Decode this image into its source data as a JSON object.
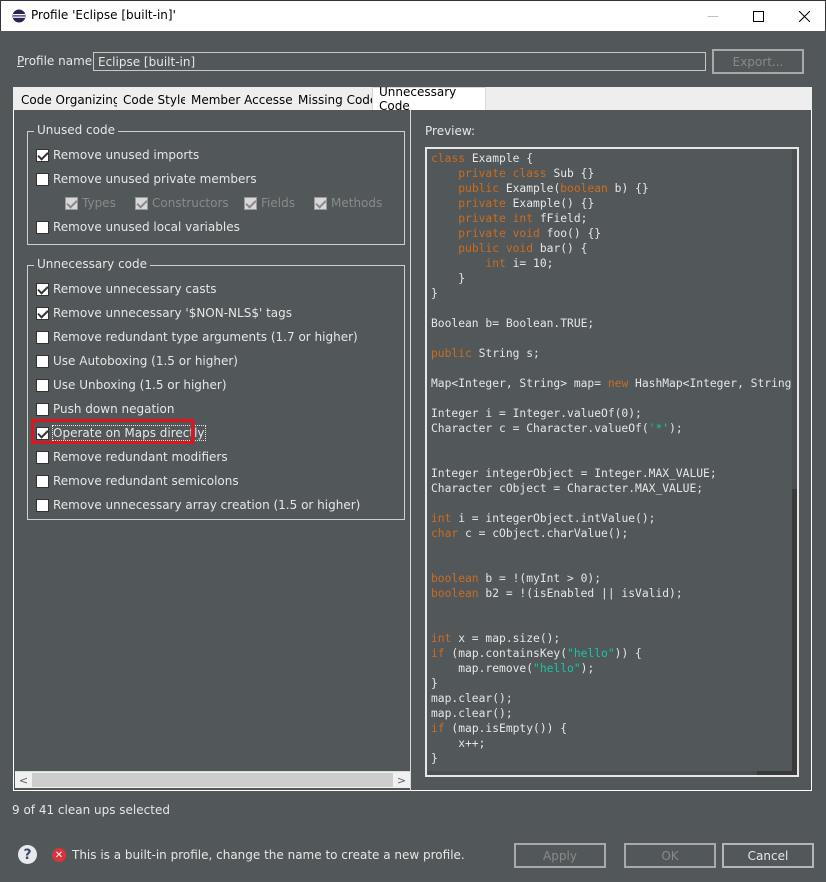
{
  "window": {
    "title": "Profile 'Eclipse [built-in]'",
    "minimize_glyph": "—",
    "maximize_glyph": "☐",
    "close_glyph": "✕"
  },
  "profile": {
    "label_prefix": "",
    "label_mnemonic": "P",
    "label_rest": "rofile name:",
    "value": "Eclipse [built-in]",
    "export_label": "Export..."
  },
  "tabs": [
    {
      "label": "Code Organizing",
      "active": false
    },
    {
      "label": "Code Style",
      "active": false
    },
    {
      "label": "Member Accesses",
      "active": false
    },
    {
      "label": "Missing Code",
      "active": false
    },
    {
      "label": "Unnecessary Code",
      "active": true
    }
  ],
  "unused_group": {
    "legend": "Unused code",
    "items": [
      {
        "label": "Remove unused imports",
        "checked": true,
        "enabled": true
      },
      {
        "label": "Remove unused private members",
        "checked": false,
        "enabled": true
      },
      {
        "label": "Remove unused local variables",
        "checked": false,
        "enabled": true
      }
    ],
    "sub_items": [
      {
        "label": "Types",
        "checked": true,
        "enabled": false
      },
      {
        "label": "Constructors",
        "checked": true,
        "enabled": false
      },
      {
        "label": "Fields",
        "checked": true,
        "enabled": false
      },
      {
        "label": "Methods",
        "checked": true,
        "enabled": false
      }
    ]
  },
  "unnecessary_group": {
    "legend": "Unnecessary code",
    "items": [
      {
        "label": "Remove unnecessary casts",
        "checked": true
      },
      {
        "label": "Remove unnecessary '$NON-NLS$' tags",
        "checked": true
      },
      {
        "label": "Remove redundant type arguments (1.7 or higher)",
        "checked": false
      },
      {
        "label": "Use Autoboxing (1.5 or higher)",
        "checked": false
      },
      {
        "label": "Use Unboxing (1.5 or higher)",
        "checked": false
      },
      {
        "label": "Push down negation",
        "checked": false
      },
      {
        "label": "Operate on Maps directly",
        "checked": true,
        "focused": true,
        "highlighted": true
      },
      {
        "label": "Remove redundant modifiers",
        "checked": false
      },
      {
        "label": "Remove redundant semicolons",
        "checked": false
      },
      {
        "label": "Remove unnecessary array creation (1.5 or higher)",
        "checked": false
      }
    ]
  },
  "preview": {
    "label": "Preview:",
    "code_lines": [
      [
        [
          "kw",
          "class"
        ],
        [
          "t",
          " Example {"
        ]
      ],
      [
        [
          "t",
          "    "
        ],
        [
          "kw",
          "private class"
        ],
        [
          "t",
          " Sub {}"
        ]
      ],
      [
        [
          "t",
          "    "
        ],
        [
          "kw",
          "public"
        ],
        [
          "t",
          " Example("
        ],
        [
          "kw",
          "boolean"
        ],
        [
          "t",
          " b) {}"
        ]
      ],
      [
        [
          "t",
          "    "
        ],
        [
          "kw",
          "private"
        ],
        [
          "t",
          " Example() {}"
        ]
      ],
      [
        [
          "t",
          "    "
        ],
        [
          "kw",
          "private int"
        ],
        [
          "t",
          " fField;"
        ]
      ],
      [
        [
          "t",
          "    "
        ],
        [
          "kw",
          "private void"
        ],
        [
          "t",
          " foo() {}"
        ]
      ],
      [
        [
          "t",
          "    "
        ],
        [
          "kw",
          "public void"
        ],
        [
          "t",
          " bar() {"
        ]
      ],
      [
        [
          "t",
          "        "
        ],
        [
          "kw",
          "int"
        ],
        [
          "t",
          " i= 10;"
        ]
      ],
      [
        [
          "t",
          "    }"
        ]
      ],
      [
        [
          "t",
          "}"
        ]
      ],
      [
        [
          "t",
          ""
        ]
      ],
      [
        [
          "t",
          "Boolean b= Boolean.TRUE;"
        ]
      ],
      [
        [
          "t",
          ""
        ]
      ],
      [
        [
          "kw",
          "public"
        ],
        [
          "t",
          " String s;"
        ]
      ],
      [
        [
          "t",
          ""
        ]
      ],
      [
        [
          "t",
          "Map<Integer, String> map= "
        ],
        [
          "kw",
          "new"
        ],
        [
          "t",
          " HashMap<Integer, String>();"
        ]
      ],
      [
        [
          "t",
          ""
        ]
      ],
      [
        [
          "t",
          "Integer i = Integer.valueOf(0);"
        ]
      ],
      [
        [
          "t",
          "Character c = Character.valueOf("
        ],
        [
          "str",
          "'*'"
        ],
        [
          "t",
          ");"
        ]
      ],
      [
        [
          "t",
          ""
        ]
      ],
      [
        [
          "t",
          ""
        ]
      ],
      [
        [
          "t",
          "Integer integerObject = Integer.MAX_VALUE;"
        ]
      ],
      [
        [
          "t",
          "Character cObject = Character.MAX_VALUE;"
        ]
      ],
      [
        [
          "t",
          ""
        ]
      ],
      [
        [
          "kw",
          "int"
        ],
        [
          "t",
          " i = integerObject.intValue();"
        ]
      ],
      [
        [
          "kw",
          "char"
        ],
        [
          "t",
          " c = cObject.charValue();"
        ]
      ],
      [
        [
          "t",
          ""
        ]
      ],
      [
        [
          "t",
          ""
        ]
      ],
      [
        [
          "kw",
          "boolean"
        ],
        [
          "t",
          " b = !(myInt > 0);"
        ]
      ],
      [
        [
          "kw",
          "boolean"
        ],
        [
          "t",
          " b2 = !(isEnabled || isValid);"
        ]
      ],
      [
        [
          "t",
          ""
        ]
      ],
      [
        [
          "t",
          ""
        ]
      ],
      [
        [
          "kw",
          "int"
        ],
        [
          "t",
          " x = map.size();"
        ]
      ],
      [
        [
          "kw",
          "if"
        ],
        [
          "t",
          " (map.containsKey("
        ],
        [
          "str",
          "\"hello\""
        ],
        [
          "t",
          ")) {"
        ]
      ],
      [
        [
          "t",
          "    map.remove("
        ],
        [
          "str",
          "\"hello\""
        ],
        [
          "t",
          ");"
        ]
      ],
      [
        [
          "t",
          "}"
        ]
      ],
      [
        [
          "t",
          "map.clear();"
        ]
      ],
      [
        [
          "t",
          "map.clear();"
        ]
      ],
      [
        [
          "kw",
          "if"
        ],
        [
          "t",
          " (map.isEmpty()) {"
        ]
      ],
      [
        [
          "t",
          "    x++;"
        ]
      ],
      [
        [
          "t",
          "}"
        ]
      ]
    ]
  },
  "status": {
    "count_text": "9 of 41 clean ups selected",
    "error_text": "This is a built-in profile, change the name to create a new profile."
  },
  "buttons": {
    "apply": "Apply",
    "ok": "OK",
    "cancel": "Cancel"
  },
  "colors": {
    "background": "#52575A",
    "keyword": "#CC6C1D",
    "string": "#17C6A3",
    "text": "#E6E6E6",
    "highlight": "#E0141E"
  }
}
